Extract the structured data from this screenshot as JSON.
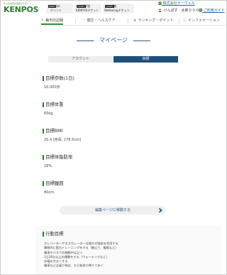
{
  "colors": {
    "brand_green": "#2f7a2c",
    "accent_navy": "#1f4e7a",
    "link_blue": "#2a5f9e",
    "title_blue": "#2b5a85"
  },
  "header": {
    "logo_tagline": "キミの未来を健康でサポート",
    "logo_text": "KENPOS",
    "pills": [
      {
        "tag": "POINT",
        "num": "0pt",
        "label": "ポイント"
      },
      {
        "tag": "TICKET",
        "num": "12枚",
        "label": "KENPOSチケット"
      },
      {
        "tag": "TICKET",
        "num": "0枚",
        "label": "Wellbeingチケット"
      }
    ],
    "company_name": "株式会社イーウェル",
    "user_name": "けんぽす　太郎０００様",
    "guide_label": "ご利用ガイド",
    "icons": {
      "building": "building-icon",
      "user": "user-icon",
      "guide": "book-icon"
    }
  },
  "nav": {
    "tabs": [
      {
        "label": "毎日の記録",
        "icon": "pencil-icon"
      },
      {
        "label": "健診・ヘルスケア",
        "icon": "heart-icon"
      },
      {
        "label": "ランキング・ポイント",
        "icon": "trophy-icon"
      },
      {
        "label": "インフォメーション",
        "icon": "info-icon"
      }
    ]
  },
  "page": {
    "title": "マイページ"
  },
  "tabs": {
    "account": "アカウント",
    "goal": "目標"
  },
  "goals": [
    {
      "heading": "目標歩数(1日)",
      "value": "10,000歩"
    },
    {
      "heading": "目標体重",
      "value": "65kg"
    },
    {
      "heading": "目標BMI",
      "value": "20.4 [身長: 178.5cm]"
    },
    {
      "heading": "目標体脂肪率",
      "value": "18%"
    },
    {
      "heading": "目標腹囲",
      "value": "80cm"
    }
  ],
  "edit_button": {
    "label": "編集ページに移動する"
  },
  "action": {
    "heading": "行動目標",
    "items": [
      "エレベーターやエスカレーターは使わず階段を利用する",
      "積極的に筋力トレーニングをする（腕立て、腹筋など）",
      "電車やバスでの移動中は立つ",
      "1日30分以上の運動をする（ウォーキングなど）",
      "歩幅を大きくする",
      "電車などは乗り物は、ひと駅前で降りて歩く"
    ]
  }
}
